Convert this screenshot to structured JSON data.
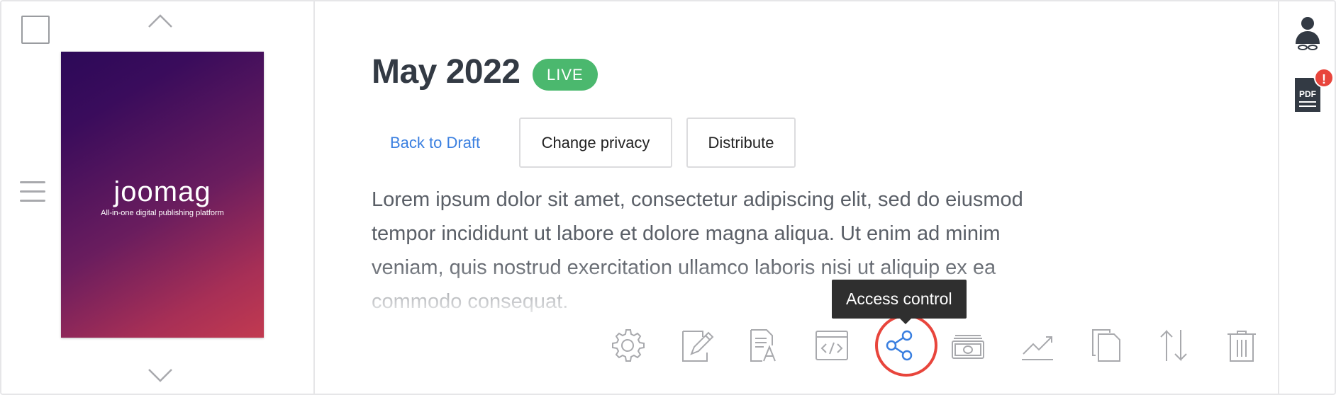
{
  "issue": {
    "title": "May 2022",
    "status_badge": "LIVE",
    "description": "Lorem ipsum dolor sit amet, consectetur adipiscing elit, sed do eiusmod tempor incididunt ut labore et dolore magna aliqua. Ut enim ad minim veniam, quis nostrud exercitation ullamco laboris nisi ut aliquip ex ea commodo consequat."
  },
  "cover": {
    "logo_text": "joomag",
    "tagline": "All-in-one digital publishing platform"
  },
  "actions": {
    "back_to_draft": "Back to Draft",
    "change_privacy": "Change privacy",
    "distribute": "Distribute"
  },
  "toolbar": {
    "tooltip": "Access control",
    "tools": [
      {
        "name": "settings",
        "icon": "gear-icon"
      },
      {
        "name": "edit",
        "icon": "pencil-icon"
      },
      {
        "name": "text",
        "icon": "text-document-icon"
      },
      {
        "name": "embed",
        "icon": "code-icon"
      },
      {
        "name": "access-control",
        "icon": "share-icon",
        "active": true
      },
      {
        "name": "monetize",
        "icon": "money-icon"
      },
      {
        "name": "analytics",
        "icon": "chart-icon"
      },
      {
        "name": "duplicate",
        "icon": "copy-icon"
      },
      {
        "name": "sort",
        "icon": "sort-arrows-icon"
      },
      {
        "name": "delete",
        "icon": "trash-icon"
      }
    ]
  },
  "sidebar_right": {
    "pdf_label": "PDF",
    "alert_badge": "!"
  },
  "colors": {
    "accent_blue": "#3a7fe0",
    "live_green": "#4bb86e",
    "highlight_red": "#e8453c",
    "icon_gray": "#a8a9ad"
  }
}
